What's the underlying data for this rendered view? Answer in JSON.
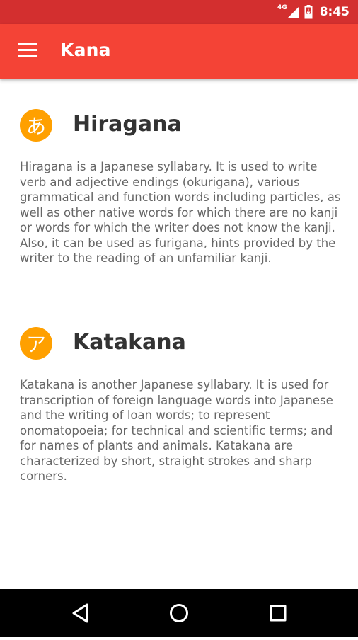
{
  "status_bar": {
    "network": "4G",
    "time": "8:45"
  },
  "app_bar": {
    "title": "Kana",
    "menu_icon": "hamburger-menu-icon"
  },
  "cards": [
    {
      "badge": "あ",
      "title": "Hiragana",
      "body": "Hiragana is a Japanese syllabary. It is used to write verb and adjective endings (okurigana), various grammatical and function words including particles, as well as other native words for which there are no kanji or words for which the writer does not know the kanji. Also, it can be used as furigana, hints provided by the writer to the reading of an unfamiliar kanji."
    },
    {
      "badge": "ア",
      "title": "Katakana",
      "body": "Katakana is another Japanese syllabary. It is used for transcription of foreign language words into Japanese and the writing of loan words; to represent onomatopoeia; for technical and scientific terms; and for names of plants and animals. Katakana are characterized by short, straight strokes and sharp corners."
    }
  ],
  "nav_bar": {
    "back_icon": "back-triangle-icon",
    "home_icon": "home-circle-icon",
    "recents_icon": "recents-square-icon"
  },
  "colors": {
    "status_bar": "#d32f2f",
    "app_bar": "#f44336",
    "badge": "#ffa000"
  }
}
